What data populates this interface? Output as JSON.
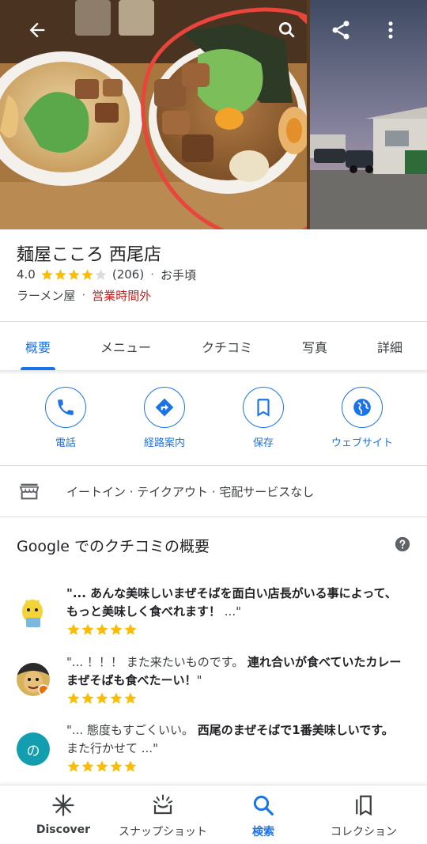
{
  "header": {
    "back_icon": "arrow-back-icon",
    "share_icon": "share-icon",
    "more_icon": "more-vert-icon"
  },
  "place": {
    "name": "麺屋こころ 西尾店",
    "rating": "4.0",
    "rating_value": 4,
    "review_count": "(206)",
    "price": "お手頃",
    "category": "ラーメン屋",
    "status": "営業時間外"
  },
  "tabs": [
    {
      "label": "概要",
      "active": true
    },
    {
      "label": "メニュー"
    },
    {
      "label": "クチコミ"
    },
    {
      "label": "写真"
    },
    {
      "label": "詳細"
    }
  ],
  "actions": [
    {
      "label": "電話",
      "icon": "phone-icon"
    },
    {
      "label": "経路案内",
      "icon": "directions-icon"
    },
    {
      "label": "保存",
      "icon": "bookmark-icon"
    },
    {
      "label": "ウェブサイト",
      "icon": "globe-icon"
    }
  ],
  "services": {
    "icon": "storefront-icon",
    "text": "イートイン · テイクアウト · 宅配サービスなし"
  },
  "reviews_summary": {
    "title": "Google でのクチコミの概要",
    "help_icon": "help-icon",
    "reviews": [
      {
        "line1_bold": "\"... あんな美味しいまぜそばを面白い店長がいる事によって、",
        "line2_bold": "もっと美味しく食べれます！",
        "line2_tail": " ...\"",
        "stars": 5
      },
      {
        "line1_plain": "\"... ！！！ また来たいものです。 ",
        "line1_bold": "連れ合いが食べていたカレー",
        "line2_bold": "まぜそばも食べたーい！",
        "line2_tail": "\"",
        "stars": 5
      },
      {
        "avatar_letter": "の",
        "line1_plain": "\"... 態度もすごくいい。 ",
        "line1_bold": "西尾のまぜそばで1番美味しいです。",
        "line2_plain": "また行かせて ...\"",
        "stars": 5
      }
    ]
  },
  "bottom_nav": [
    {
      "label": "Discover",
      "icon": "discover-icon"
    },
    {
      "label": "スナップショット",
      "icon": "snapshot-icon"
    },
    {
      "label": "検索",
      "icon": "search-icon",
      "active": true
    },
    {
      "label": "コレクション",
      "icon": "collections-icon"
    }
  ],
  "colors": {
    "accent": "#1a73e8",
    "closed": "#c5221f",
    "star": "#fbbc04",
    "avatar_teal": "#129eaf",
    "circle_annotation": "#e8453c"
  }
}
